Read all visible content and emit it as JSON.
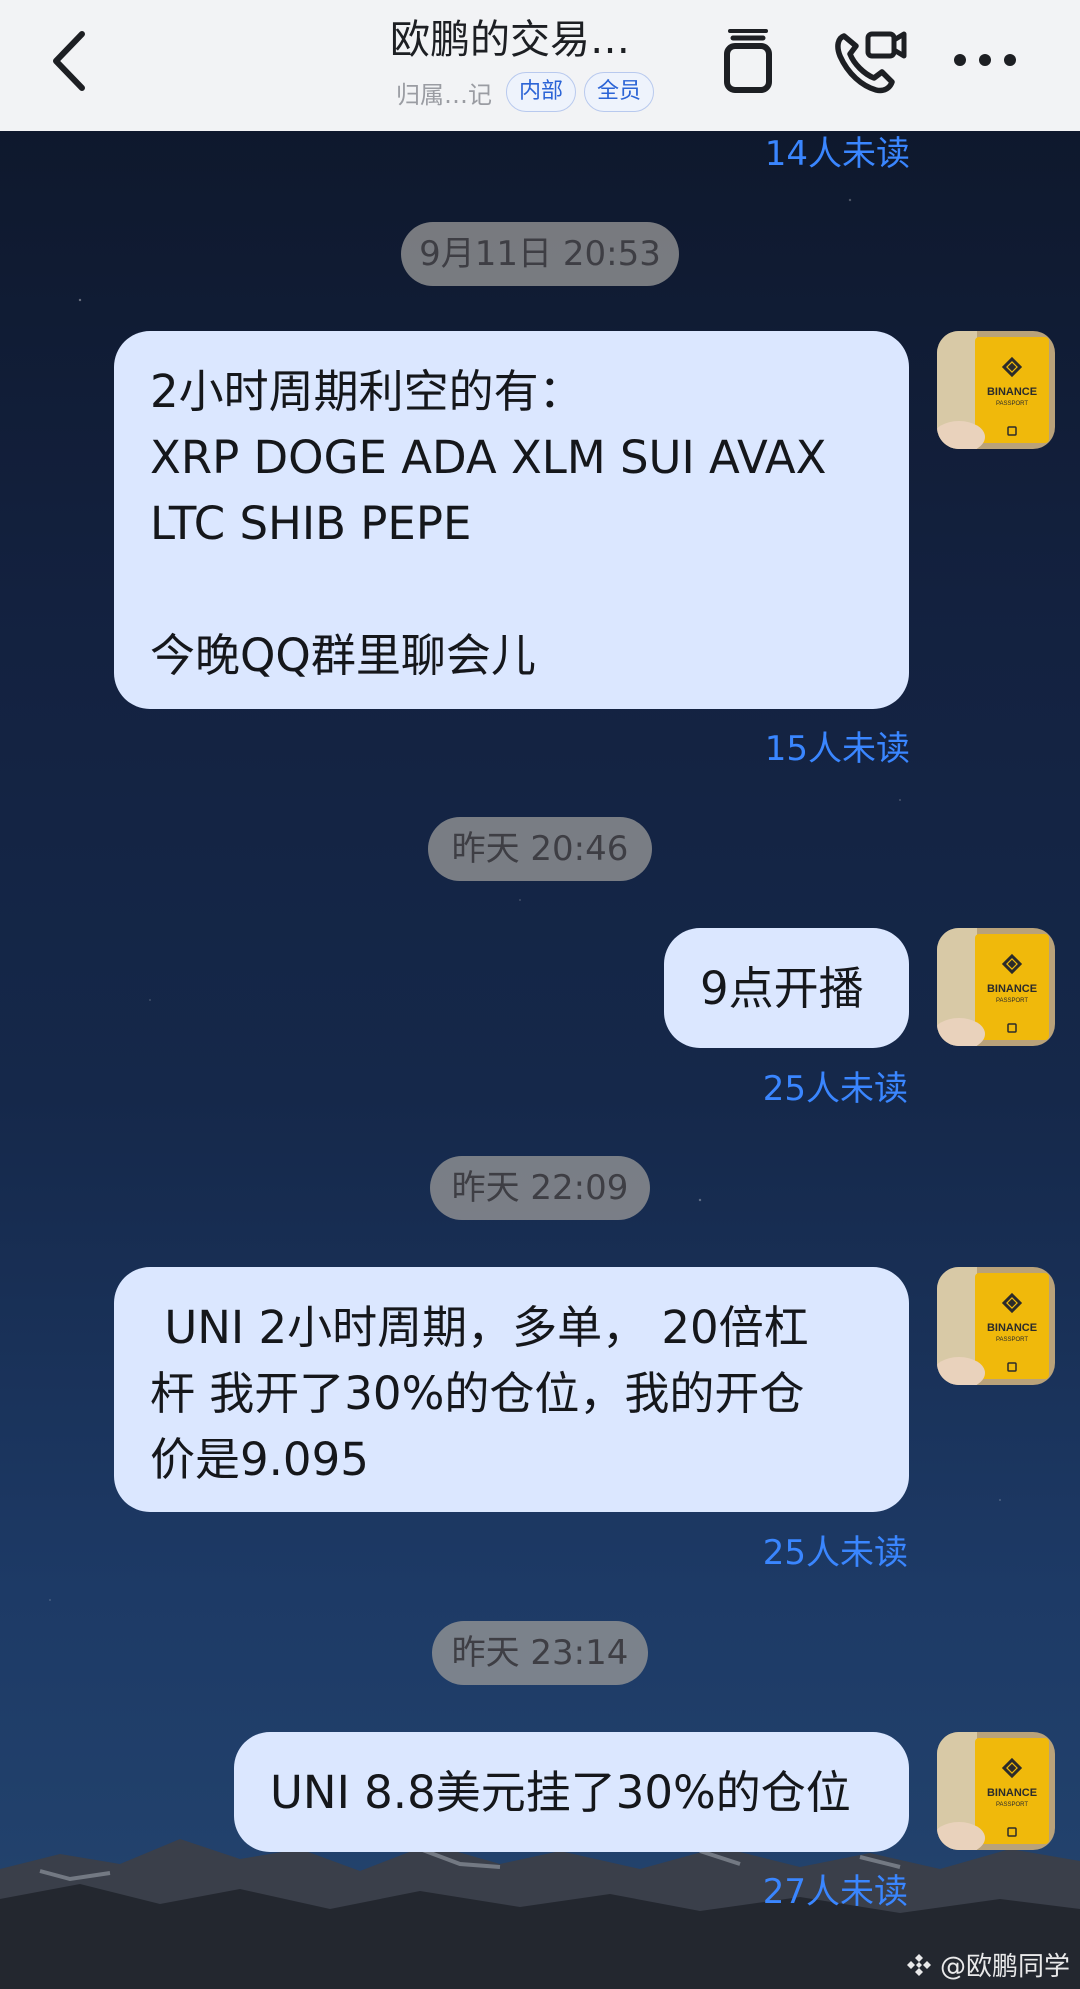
{
  "header": {
    "title": "欧鹏的交易…",
    "subtitle": "归属…记",
    "tags": [
      "内部",
      "全员"
    ]
  },
  "colors": {
    "header_bg": "#f2f3f5",
    "bubble_bg": "#dbe7ff",
    "read_status": "#3a86ff",
    "timestamp_bg": "#969696"
  },
  "messages": [
    {
      "read": "14人未读"
    },
    {
      "time": "9月11日 20:53",
      "text": "2小时周期利空的有：\nXRP DOGE ADA XLM SUI AVAX\nLTC SHIB PEPE\n\n今晚QQ群里聊会儿",
      "read": "15人未读",
      "avatar": "BINANCE"
    },
    {
      "time": "昨天 20:46",
      "text": "9点开播",
      "read": "25人未读",
      "avatar": "BINANCE"
    },
    {
      "time": "昨天 22:09",
      "text": " UNI 2小时周期，多单， 20倍杠\n杆 我开了30%的仓位，我的开仓\n价是9.095",
      "read": "25人未读",
      "avatar": "BINANCE"
    },
    {
      "time": "昨天 23:14",
      "text": "UNI 8.8美元挂了30%的仓位",
      "read": "27人未读",
      "avatar": "BINANCE"
    }
  ],
  "avatar_sub": "PASSPORT",
  "watermark": "@欧鹏同学"
}
